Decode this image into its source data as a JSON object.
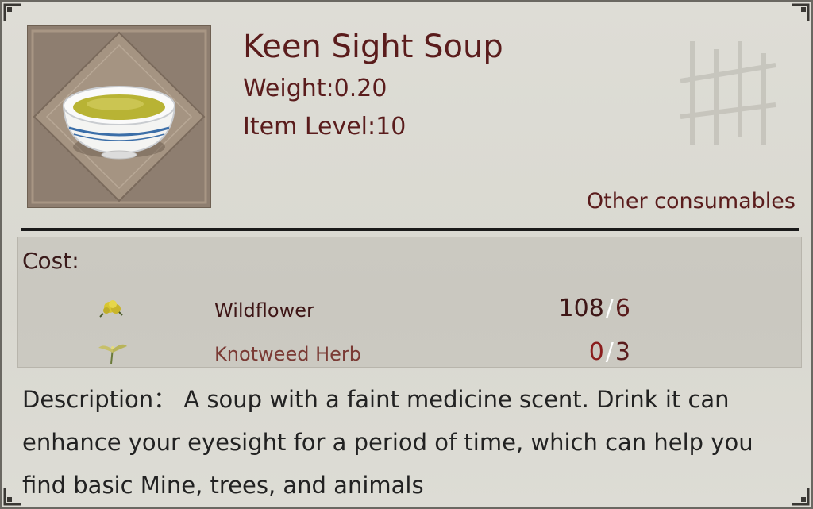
{
  "item": {
    "name": "Keen Sight Soup",
    "weight": "Weight:0.20",
    "item_level": "Item Level:10",
    "category": "Other consumables",
    "icon": "soup-bowl-icon"
  },
  "cost": {
    "label": "Cost:",
    "materials": [
      {
        "name": "Wildflower",
        "have": "108",
        "sep": "/",
        "need": "6",
        "icon": "wildflower-icon",
        "sufficient": true
      },
      {
        "name": "Knotweed Herb",
        "have": "0",
        "sep": "/",
        "need": "3",
        "icon": "knotweed-herb-icon",
        "sufficient": false
      }
    ]
  },
  "description": {
    "text": "Description： A soup with a faint medicine scent. Drink it can enhance your eyesight for a period of time, which can help you find basic Mine, trees, and animals"
  },
  "colors": {
    "title": "#5a1c1c",
    "insufficient": "#8a1d1d",
    "panel_bg": "#dcdad2",
    "divider": "#1a1a1a"
  }
}
